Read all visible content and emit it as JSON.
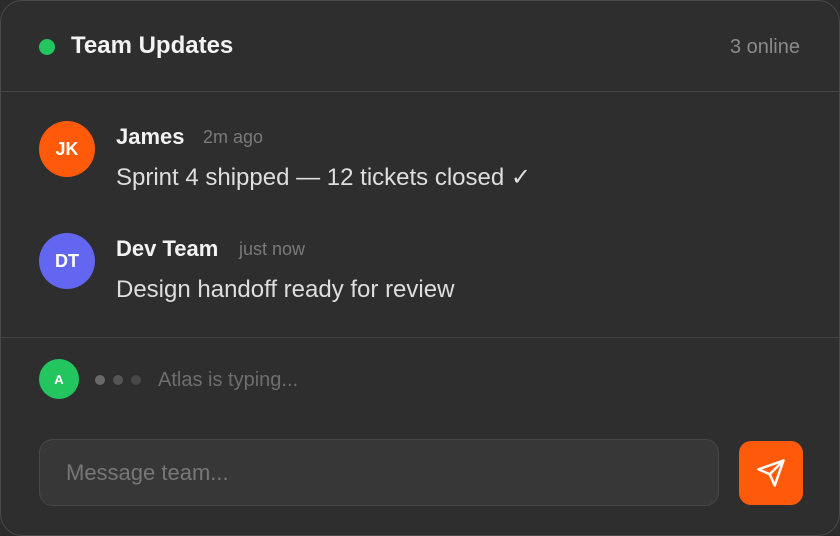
{
  "header": {
    "title": "Team Updates",
    "online_count": "3 online",
    "status_color": "#22c55e"
  },
  "messages": [
    {
      "initials": "JK",
      "author": "James",
      "time": "2m ago",
      "text": "Sprint 4 shipped — 12 tickets closed ✓",
      "avatar_color": "#ff5a0a"
    },
    {
      "initials": "DT",
      "author": "Dev Team",
      "time": "just now",
      "text": "Design handoff ready for review",
      "avatar_color": "#6366f1"
    }
  ],
  "typing": {
    "initial": "A",
    "text": "Atlas is typing...",
    "avatar_color": "#22c55e"
  },
  "composer": {
    "placeholder": "Message team...",
    "send_icon": "send-icon",
    "send_color": "#ff5a0a"
  }
}
